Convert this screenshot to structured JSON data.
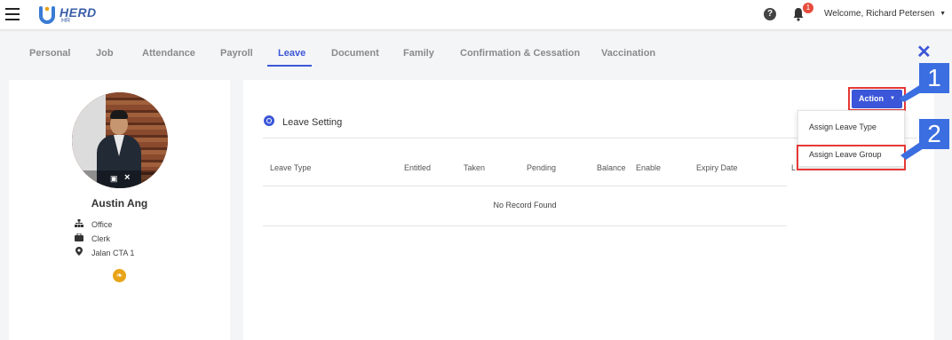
{
  "header": {
    "logo_text": "HERD",
    "logo_sub": "HR",
    "notification_count": "1",
    "welcome_prefix": "Welcome,",
    "user_name": "Richard Petersen"
  },
  "tabs": [
    {
      "label": "Personal",
      "active": false
    },
    {
      "label": "Job",
      "active": false
    },
    {
      "label": "Attendance",
      "active": false
    },
    {
      "label": "Payroll",
      "active": false
    },
    {
      "label": "Leave",
      "active": true
    },
    {
      "label": "Document",
      "active": false
    },
    {
      "label": "Family",
      "active": false
    },
    {
      "label": "Confirmation & Cessation",
      "active": false
    },
    {
      "label": "Vaccination",
      "active": false
    }
  ],
  "employee": {
    "name": "Austin Ang",
    "department": "Office",
    "position": "Clerk",
    "location": "Jalan CTA 1"
  },
  "leave": {
    "section_title": "Leave Setting",
    "columns": [
      "Leave Type",
      "Entitled",
      "Taken",
      "Pending",
      "Balance",
      "Enable",
      "Expiry Date",
      "L"
    ],
    "empty_message": "No Record Found"
  },
  "action_menu": {
    "button_label": "Action",
    "items": [
      "Assign Leave Type",
      "Assign Leave Group"
    ]
  },
  "callouts": [
    "1",
    "2"
  ],
  "colors": {
    "accent": "#3b56d8",
    "highlight": "#e53935",
    "callout": "#3b6ee0"
  }
}
